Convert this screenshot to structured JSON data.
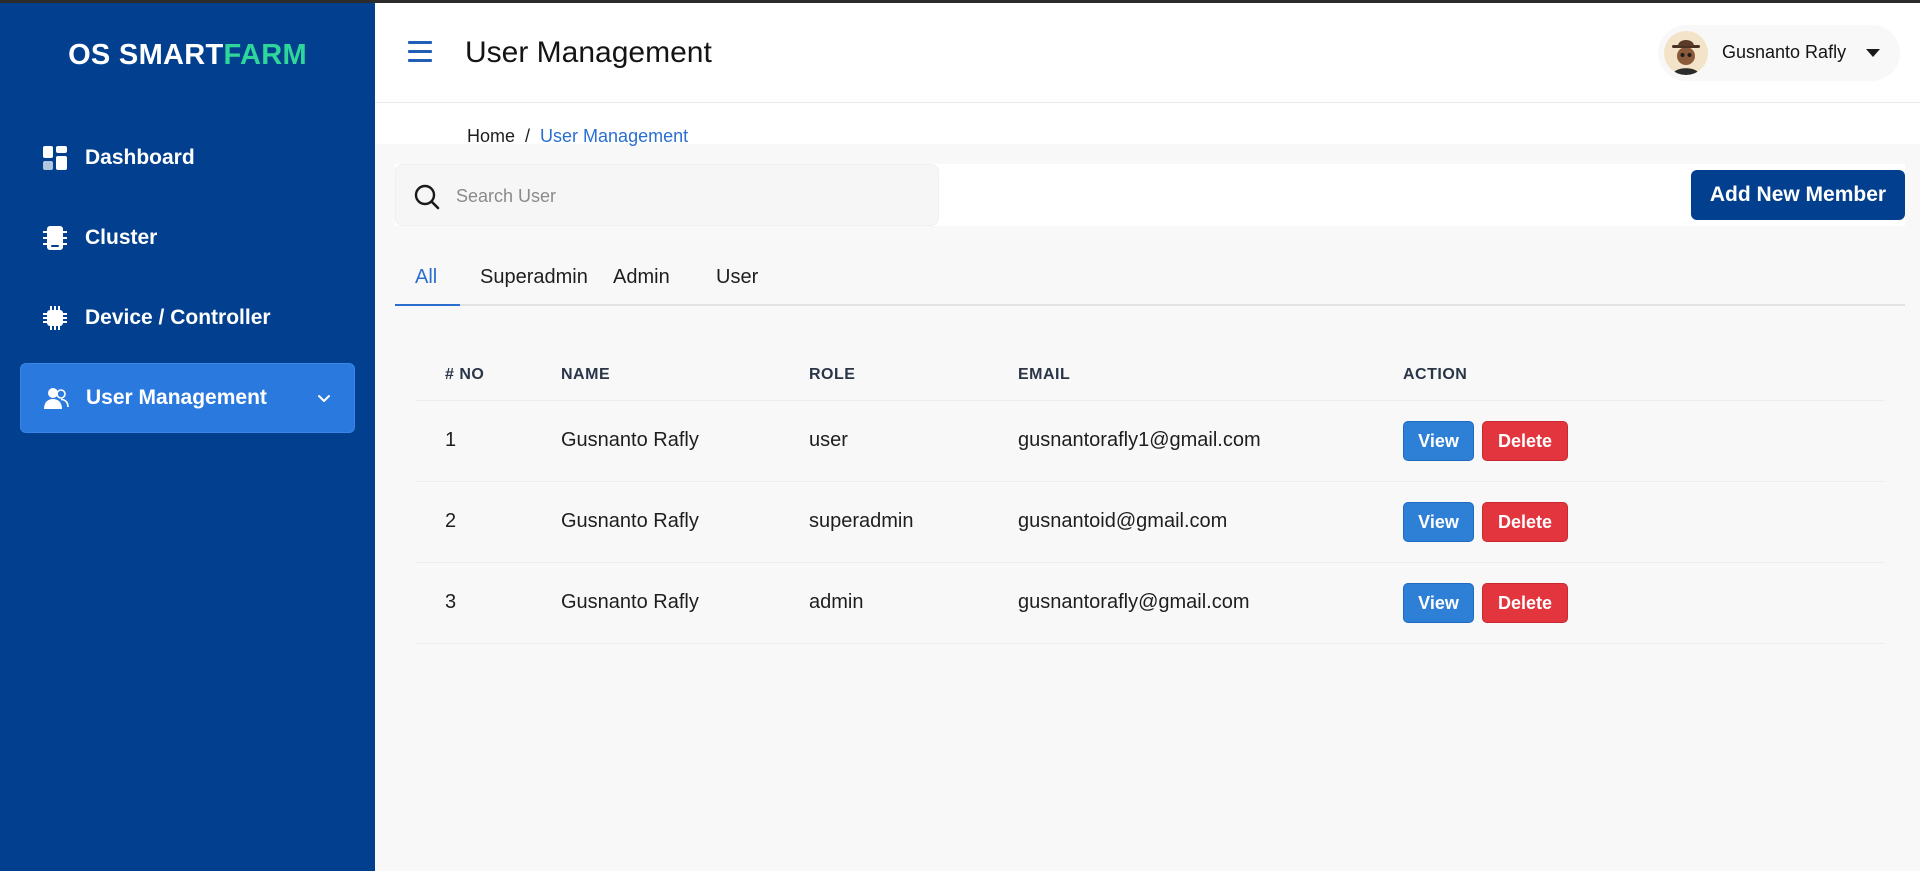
{
  "app": {
    "logo_prefix": "OS SMART",
    "logo_suffix": "FARM",
    "brand_color": "#02408f",
    "accent_color": "#2fd69a"
  },
  "sidebar": {
    "items": [
      {
        "label": "Dashboard",
        "icon": "dashboard-icon"
      },
      {
        "label": "Cluster",
        "icon": "cluster-icon"
      },
      {
        "label": "Device / Controller",
        "icon": "chip-icon"
      },
      {
        "label": "User Management",
        "icon": "users-icon",
        "active": true
      }
    ]
  },
  "header": {
    "title": "User Management",
    "user_name": "Gusnanto Rafly"
  },
  "breadcrumb": {
    "home": "Home",
    "separator": "/",
    "current": "User Management"
  },
  "toolbar": {
    "search_placeholder": "Search User",
    "add_label": "Add New Member"
  },
  "tabs": [
    {
      "label": "All",
      "active": true
    },
    {
      "label": "Superadmin"
    },
    {
      "label": "Admin"
    },
    {
      "label": "User"
    }
  ],
  "table": {
    "columns": [
      "# NO",
      "NAME",
      "ROLE",
      "EMAIL",
      "ACTION"
    ],
    "rows": [
      {
        "no": "1",
        "name": "Gusnanto Rafly",
        "role": "user",
        "email": "gusnantorafly1@gmail.com"
      },
      {
        "no": "2",
        "name": "Gusnanto Rafly",
        "role": "superadmin",
        "email": "gusnantoid@gmail.com"
      },
      {
        "no": "3",
        "name": "Gusnanto Rafly",
        "role": "admin",
        "email": "gusnantorafly@gmail.com"
      }
    ],
    "view_label": "View",
    "delete_label": "Delete"
  }
}
